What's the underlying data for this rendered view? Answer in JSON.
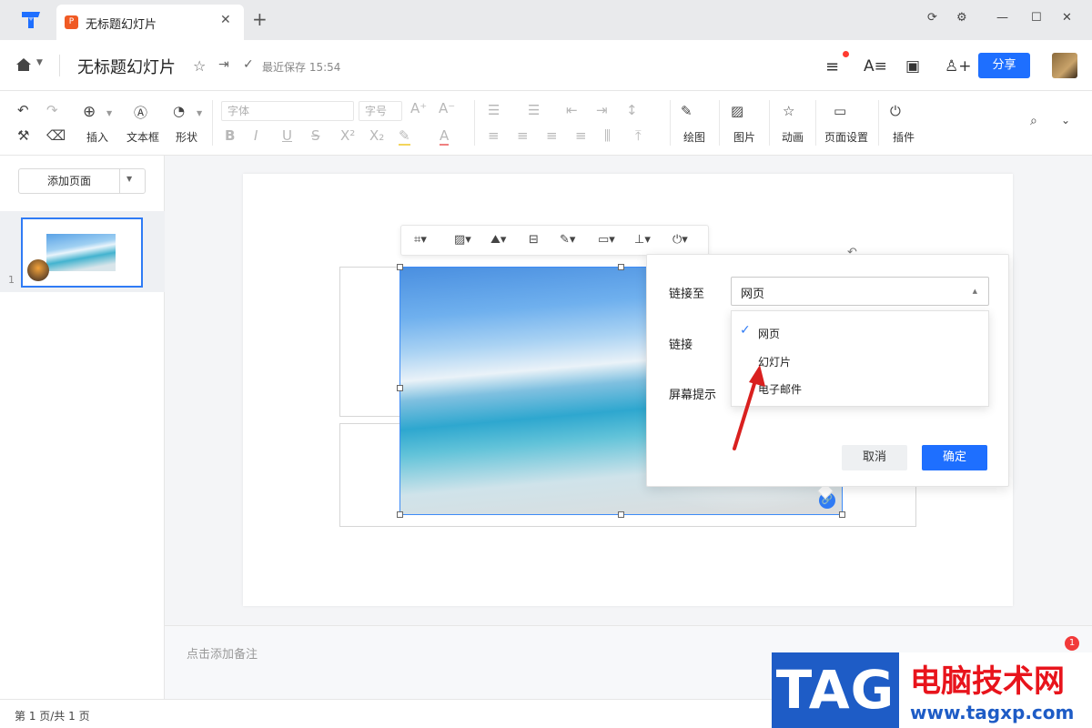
{
  "window": {
    "tab_title": "无标题幻灯片",
    "tab_icon": "ppt-icon",
    "controls": [
      "refresh-icon",
      "settings-icon",
      "minimize-icon",
      "maximize-icon",
      "close-icon"
    ]
  },
  "header": {
    "doc_title": "无标题幻灯片",
    "save_status": "最近保存 15:54",
    "share_label": "分享"
  },
  "toolbar": {
    "insert_label": "插入",
    "textbox_label": "文本框",
    "shape_label": "形状",
    "font_placeholder": "字体",
    "fontsize_placeholder": "字号",
    "draw_label": "绘图",
    "image_label": "图片",
    "animation_label": "动画",
    "page_setup_label": "页面设置",
    "plugin_label": "插件"
  },
  "sidebar": {
    "add_page_label": "添加页面",
    "slides": [
      {
        "number": "1"
      }
    ]
  },
  "link_dialog": {
    "link_to_label": "链接至",
    "link_label": "链接",
    "screen_tip_label": "屏幕提示",
    "selected_value": "网页",
    "options": [
      "网页",
      "幻灯片",
      "电子邮件"
    ],
    "cancel_label": "取消",
    "ok_label": "确定"
  },
  "notes": {
    "placeholder": "点击添加备注",
    "badge_count": "1"
  },
  "status": {
    "page_info": "第 1 页/共 1 页"
  },
  "watermark": {
    "tag": "TAG",
    "site_name": "电脑技术网",
    "url": "www.tagxp.com"
  },
  "colors": {
    "accent": "#1e6fff",
    "arrow": "#d9201f"
  }
}
